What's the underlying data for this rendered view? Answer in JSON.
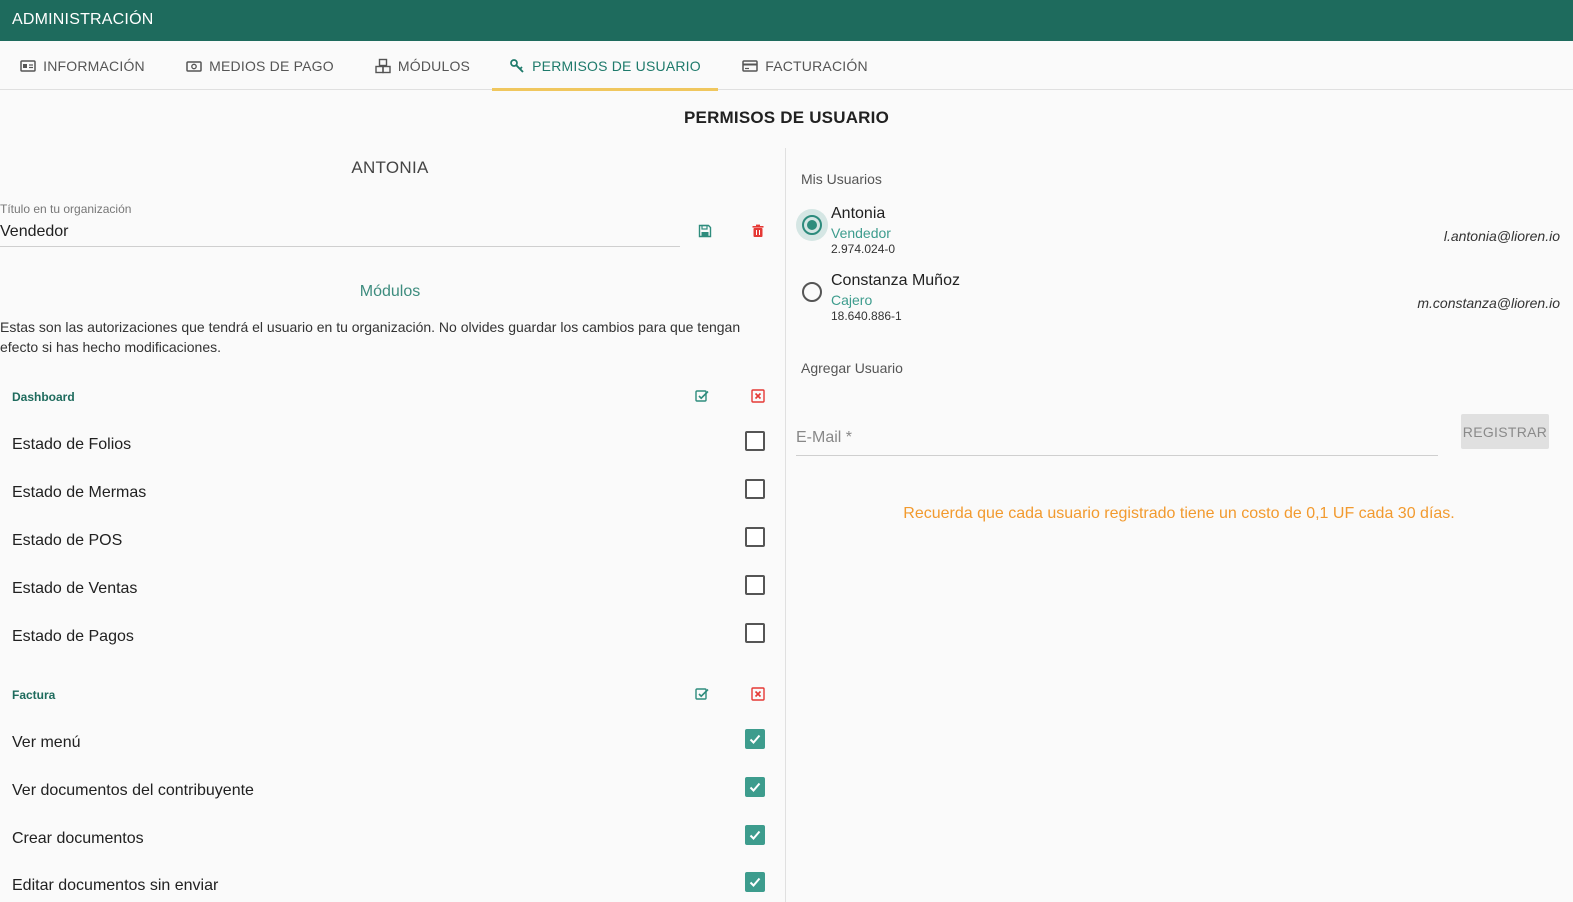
{
  "appbar": {
    "title": "ADMINISTRACIÓN"
  },
  "tabs": [
    {
      "label": "INFORMACIÓN",
      "icon": "id-card-icon"
    },
    {
      "label": "MEDIOS DE PAGO",
      "icon": "money-icon"
    },
    {
      "label": "MÓDULOS",
      "icon": "cubes-icon"
    },
    {
      "label": "PERMISOS DE USUARIO",
      "icon": "key-icon",
      "active": true
    },
    {
      "label": "FACTURACIÓN",
      "icon": "credit-card-icon"
    }
  ],
  "page_title": "PERMISOS DE USUARIO",
  "left": {
    "user_name": "ANTONIA",
    "title_field": {
      "label": "Título en tu organización",
      "value": "Vendedor"
    },
    "modules_title": "Módulos",
    "modules_desc": "Estas son las autorizaciones que tendrá el usuario en tu organización. No olvides guardar los cambios para que tengan efecto si has hecho modificaciones.",
    "sections": [
      {
        "title": "Dashboard",
        "items": [
          {
            "label": "Estado de Folios",
            "checked": false
          },
          {
            "label": "Estado de Mermas",
            "checked": false
          },
          {
            "label": "Estado de POS",
            "checked": false
          },
          {
            "label": "Estado de Ventas",
            "checked": false
          },
          {
            "label": "Estado de Pagos",
            "checked": false
          }
        ]
      },
      {
        "title": "Factura",
        "items": [
          {
            "label": "Ver menú",
            "checked": true
          },
          {
            "label": "Ver documentos del contribuyente",
            "checked": true
          },
          {
            "label": "Crear documentos",
            "checked": true
          },
          {
            "label": "Editar documentos sin enviar",
            "checked": true
          }
        ]
      }
    ]
  },
  "right": {
    "mis_usuarios": "Mis Usuarios",
    "users": [
      {
        "name": "Antonia",
        "role": "Vendedor",
        "rut": "2.974.024-0",
        "email": "l.antonia@lioren.io",
        "selected": true
      },
      {
        "name": "Constanza Muñoz",
        "role": "Cajero",
        "rut": "18.640.886-1",
        "email": "m.constanza@lioren.io",
        "selected": false
      }
    ],
    "agregar_title": "Agregar Usuario",
    "email_placeholder": "E-Mail *",
    "register_label": "REGISTRAR",
    "notice": "Recuerda que cada usuario registrado tiene un costo de 0,1 UF cada 30 días."
  },
  "colors": {
    "primary": "#1e6b5d",
    "accent_teal": "#3d9c8d",
    "tab_indicator": "#f0c75e",
    "danger": "#e53935",
    "warning": "#f29a2e"
  }
}
